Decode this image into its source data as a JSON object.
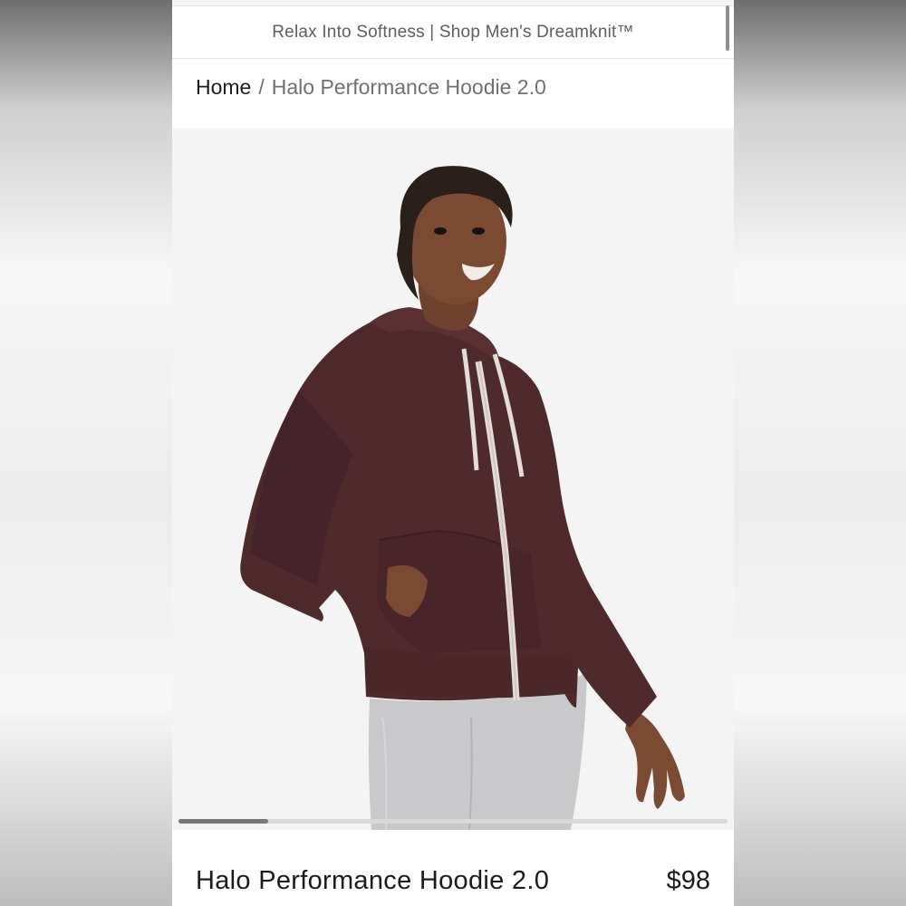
{
  "promo_banner": {
    "text": "Relax Into Softness | Shop Men's Dreamknit™"
  },
  "breadcrumb": {
    "home": "Home",
    "separator": "/",
    "current": "Halo Performance Hoodie 2.0"
  },
  "product_image": {
    "alt": "Model wearing maroon full-zip hoodie with grey joggers"
  },
  "carousel": {
    "position": 1,
    "count": 6
  },
  "product": {
    "title": "Halo Performance Hoodie 2.0",
    "price": "$98"
  },
  "colors": {
    "hoodie": "#4f2a2c",
    "drawcord": "#e4dcd6",
    "pants": "#c9c9cb",
    "skin": "#7a4a33",
    "hair": "#2a1f1a",
    "background": "#f4f4f5"
  }
}
